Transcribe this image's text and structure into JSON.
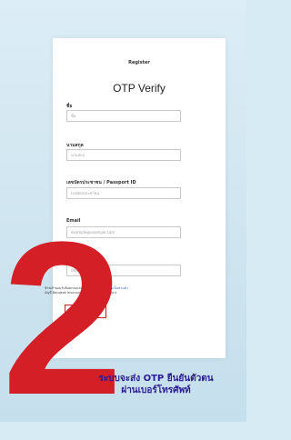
{
  "brand": "Register",
  "title": "OTP Verify",
  "fields": [
    {
      "label": "ชื่อ",
      "placeholder": "ชื่อ"
    },
    {
      "label": "นามสกุล",
      "placeholder": "นามสกุล"
    },
    {
      "label": "เลขบัตรประชาชน / Passport ID",
      "placeholder": "เลขบัตรประชาชน"
    },
    {
      "label": "Email",
      "placeholder": "example@example.com"
    },
    {
      "label": "หมายเลขโทรศัพท์",
      "placeholder": "08xxxxxxxx"
    }
  ],
  "consent": {
    "text": "ข้าพเจ้ายอมรับข้อตกลงและเงื่อนไข",
    "link": "นโยบายความเป็นส่วนตัว",
    "account": "บัญชี Bangkok Insurance Line Official Account"
  },
  "cta_label": "Request OTP",
  "numeral": "2",
  "caption": {
    "line1": "ระบบจะส่ง OTP ยืนยันตัวตน",
    "line2": "ผ่านเบอร์โทรศัพท์"
  },
  "colors": {
    "background": "#d7ebf5",
    "accent": "#d41f26",
    "caption": "#2a1b8f",
    "link": "#3a66c9"
  }
}
